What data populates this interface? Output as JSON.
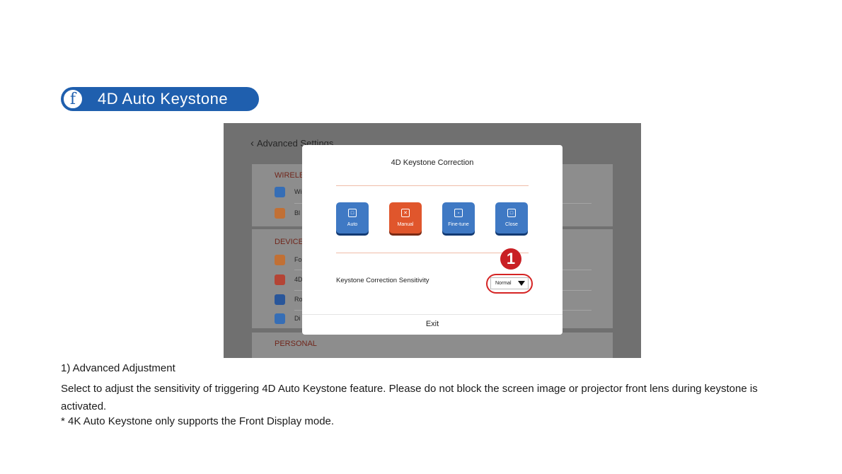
{
  "section": {
    "letter": "f",
    "title": "4D Auto Keystone"
  },
  "screenshot": {
    "back_label": "Advanced Settings",
    "background_headers": [
      "WIRELE",
      "DEVICE",
      "PERSONAL"
    ],
    "background_items": [
      "Wi",
      "Bl",
      "Fo",
      "4D",
      "Ro",
      "Di"
    ],
    "dialog": {
      "title": "4D Keystone Correction",
      "options": [
        {
          "label": "Auto",
          "icon": "auto-icon",
          "color": "#3f79c4"
        },
        {
          "label": "Manual",
          "icon": "manual-icon",
          "color": "#e0562c"
        },
        {
          "label": "Fine-tune",
          "icon": "fine-tune-icon",
          "color": "#3f79c4"
        },
        {
          "label": "Close",
          "icon": "close-icon",
          "color": "#3f79c4"
        }
      ],
      "sensitivity_label": "Keystone Correction Sensitivity",
      "sensitivity_value": "Normal",
      "callout_number": "1",
      "exit_label": "Exit"
    }
  },
  "text": {
    "heading": "1) Advanced Adjustment",
    "paragraph": "Select to adjust the sensitivity of triggering 4D Auto Keystone feature. Please do not block the screen image or projector front lens during keystone is activated.",
    "note": "* 4K Auto Keystone only supports the Front Display mode."
  },
  "colors": {
    "accent": "#1f5fae",
    "callout": "#c91f24",
    "selected_option": "#e0562c"
  }
}
